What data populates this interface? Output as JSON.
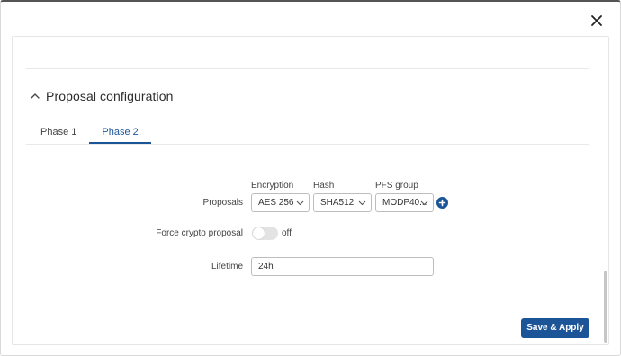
{
  "dialog": {
    "close_icon": "close-icon"
  },
  "section": {
    "title": "Proposal configuration",
    "collapse_icon": "chevron-up-icon"
  },
  "tabs": [
    {
      "label": "Phase 1",
      "active": false
    },
    {
      "label": "Phase 2",
      "active": true
    }
  ],
  "proposals": {
    "row_label": "Proposals",
    "columns": {
      "encryption_label": "Encryption",
      "hash_label": "Hash",
      "pfs_label": "PFS group"
    },
    "encryption_value": "AES 256",
    "hash_value": "SHA512",
    "pfs_value": "MODP40..."
  },
  "force_crypto": {
    "label": "Force crypto proposal",
    "state_text": "off",
    "enabled": false
  },
  "lifetime": {
    "label": "Lifetime",
    "value": "24h"
  },
  "footer": {
    "save_label": "Save & Apply"
  },
  "colors": {
    "accent": "#1c5597",
    "toggle_off": "#e3e3e3"
  }
}
